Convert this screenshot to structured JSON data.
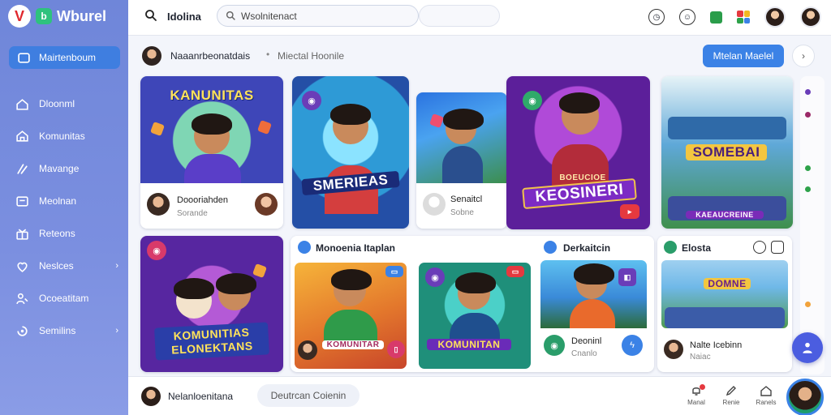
{
  "colors": {
    "sidebar": "#7387dc",
    "accent": "#3b82e6",
    "fab": "#4b5de0"
  },
  "brand": {
    "logo_letter": "V",
    "logo_badge": "b",
    "name": "Wburel"
  },
  "sidebar": {
    "active_label": "Mairtenboum",
    "items": [
      {
        "label": "Dloonml",
        "icon": "home-icon"
      },
      {
        "label": "Komunitas",
        "icon": "community-icon"
      },
      {
        "label": "Mavange",
        "icon": "sparkle-icon"
      },
      {
        "label": "Meolnan",
        "icon": "media-icon"
      },
      {
        "label": "Reteons",
        "icon": "gift-icon"
      },
      {
        "label": "Neslces",
        "icon": "heart-icon",
        "chevron": "›"
      },
      {
        "label": "Ocoeatitam",
        "icon": "user-group-icon"
      },
      {
        "label": "Semilins",
        "icon": "settings-icon",
        "chevron": "›"
      }
    ]
  },
  "topbar": {
    "title": "Idolina",
    "search_value": "Wsolnitenact",
    "icons": [
      "clock-icon",
      "smile-icon",
      "app-green-icon",
      "apps-grid-icon",
      "avatar",
      "avatar"
    ]
  },
  "subheader": {
    "name": "Naaanrbeonatdais",
    "dot": "•",
    "meta": "Miectal Hoonile",
    "button": "Mtelan Maelel",
    "next": "›"
  },
  "cards": {
    "c1": {
      "banner": "KANUNITAS",
      "caption": "Doooriahden",
      "sub": "Sorande"
    },
    "c2": {
      "banner": "SMERIEAS"
    },
    "c3": {
      "caption": "Senaitcl",
      "sub": "Sobne"
    },
    "c4": {
      "banner_small": "BOEUCIOE",
      "banner": "KEOSINERI"
    },
    "c5": {
      "banner": "SOMEBAI",
      "banner_small": "KAEAUCREINE"
    },
    "c6": {
      "banner": "KOMUNITIAS ELONEKTANS"
    },
    "row2_sections": [
      {
        "title": "Monoenia Itaplan"
      },
      {
        "title": "Derkaitcin"
      },
      {
        "title": "Elosta"
      }
    ],
    "c7": {
      "banner": "KOMUNITAR"
    },
    "c8": {
      "banner": "KOMUNITAN"
    },
    "c9": {
      "caption": "Deoninl",
      "sub": "Cnanlo"
    },
    "c10": {
      "banner": "DOMNE",
      "caption": "Nalte Icebinn",
      "sub": "Naiac"
    }
  },
  "bottombar": {
    "name": "Nelanloenitana",
    "chip": "Deutrcan Coienin",
    "tools": [
      {
        "label": "Manal",
        "icon": "bell-icon"
      },
      {
        "label": "Renie",
        "icon": "edit-icon"
      },
      {
        "label": "Ranels",
        "icon": "home-icon"
      }
    ]
  }
}
